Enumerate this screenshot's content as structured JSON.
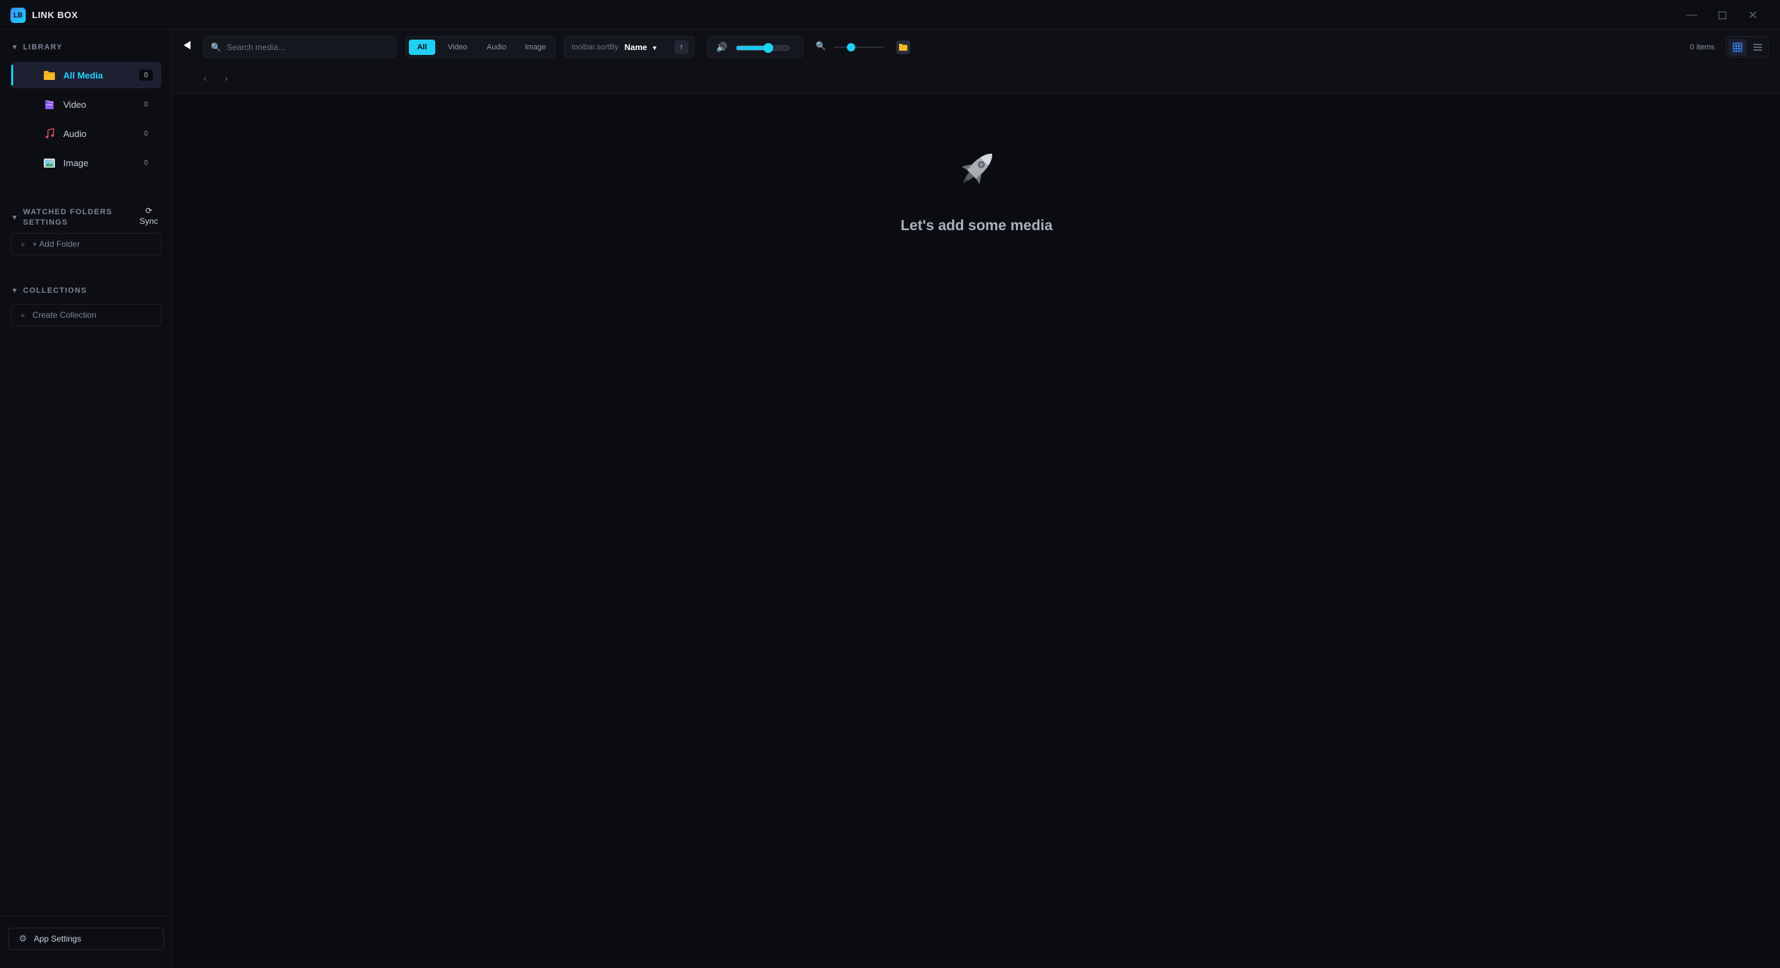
{
  "window": {
    "logo_text": "LB",
    "title": "LINK BOX"
  },
  "sidebar": {
    "library": {
      "heading": "LIBRARY",
      "items": [
        {
          "label": "All Media",
          "count": "0",
          "icon": "folder-icon",
          "active": true
        },
        {
          "label": "Video",
          "count": "0",
          "icon": "film-icon",
          "active": false
        },
        {
          "label": "Audio",
          "count": "0",
          "icon": "music-note-icon",
          "active": false
        },
        {
          "label": "Image",
          "count": "0",
          "icon": "picture-icon",
          "active": false
        }
      ]
    },
    "watched": {
      "heading_line1": "WATCHED FOLDERS",
      "heading_line2": "SETTINGS",
      "sync_label": "Sync",
      "add_label": "+ Add Folder"
    },
    "collections": {
      "heading": "COLLECTIONS",
      "create_label": "Create Collection"
    },
    "settings_label": "App Settings"
  },
  "toolbar": {
    "search_placeholder": "Search media...",
    "filters": [
      "All",
      "Video",
      "Audio",
      "Image"
    ],
    "active_filter": "All",
    "sort_label": "toolbar.sortBy",
    "sort_value": "Name",
    "volume_percent": 60,
    "zoom_percent": 35,
    "items_count": "0 items"
  },
  "empty_state": {
    "message": "Let's add some media"
  },
  "colors": {
    "accent": "#1fd0f5",
    "background": "#0b0c10",
    "sidebar": "#0d0e13"
  }
}
